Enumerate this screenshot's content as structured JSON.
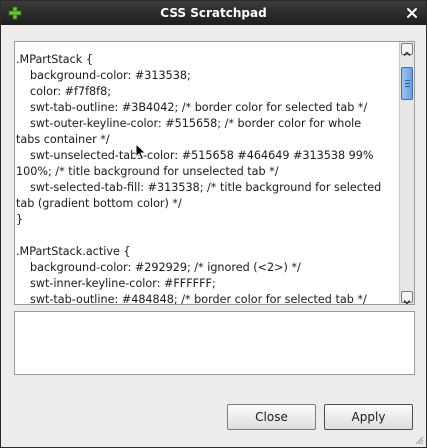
{
  "window": {
    "title": "CSS Scratchpad"
  },
  "editor": {
    "lines": [
      {
        "text": ".MPartStack {",
        "indent": false
      },
      {
        "text": "background-color: #313538;",
        "indent": true
      },
      {
        "text": "color: #f7f8f8;",
        "indent": true
      },
      {
        "text": "swt-tab-outline: #3B4042; /* border color for selected tab */",
        "indent": true
      },
      {
        "text": "swt-outer-keyline-color: #515658; /* border color for whole",
        "indent": true
      },
      {
        "text": "tabs container */",
        "indent": false
      },
      {
        "text": "swt-unselected-tabs-color: #515658 #464649 #313538 99%",
        "indent": true
      },
      {
        "text": "100%; /* title background for unselected tab */",
        "indent": false
      },
      {
        "text": "swt-selected-tab-fill: #313538; /* title background for selected",
        "indent": true
      },
      {
        "text": "tab (gradient bottom color) */",
        "indent": false
      },
      {
        "text": "}",
        "indent": false
      },
      {
        "text": "",
        "indent": false
      },
      {
        "text": ".MPartStack.active {",
        "indent": false
      },
      {
        "text": "background-color: #292929;   /* ignored (<2>) */",
        "indent": true
      },
      {
        "text": "swt-inner-keyline-color: #FFFFFF;",
        "indent": true
      },
      {
        "text": "swt-tab-outline: #484848; /* border color for selected tab */",
        "indent": true
      }
    ],
    "scroll_position": 0.05
  },
  "output": {
    "value": ""
  },
  "buttons": {
    "close_label": "Close",
    "apply_label": "Apply"
  },
  "icons": {
    "window_menu": "plus-icon",
    "window_close": "close-icon",
    "pointer": "cursor-icon"
  },
  "colors": {
    "titlebar": "#2a2a2a",
    "title_text": "#ffffff",
    "scroll_thumb": "#6aa0df",
    "window_bg": "#edecea"
  }
}
